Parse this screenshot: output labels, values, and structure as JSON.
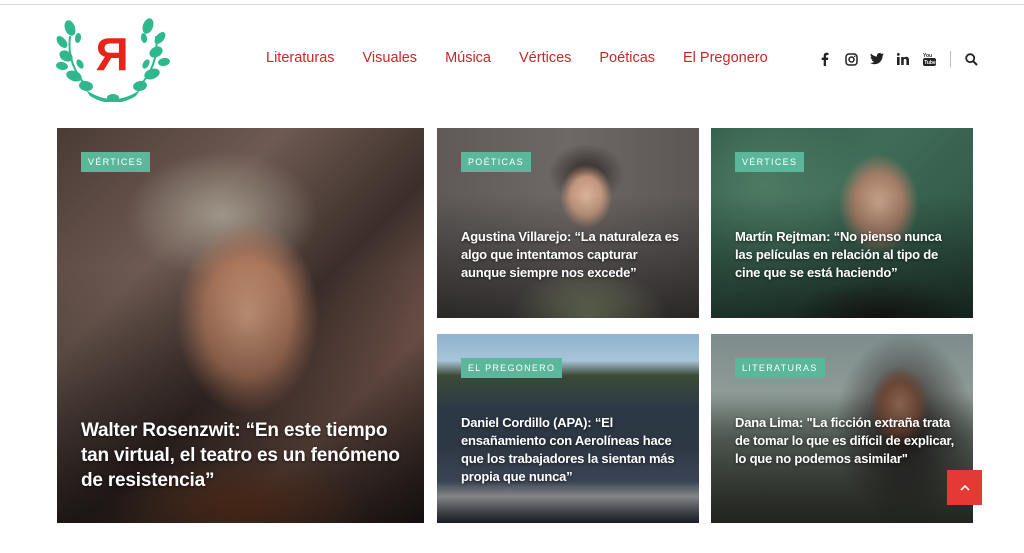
{
  "site": {
    "logo_letter": "R",
    "brand_color": "#e8241a",
    "laurel_color": "#2fb88e"
  },
  "nav": {
    "items": [
      {
        "label": "Literaturas"
      },
      {
        "label": "Visuales"
      },
      {
        "label": "Música"
      },
      {
        "label": "Vértices"
      },
      {
        "label": "Poéticas"
      },
      {
        "label": "El Pregonero"
      }
    ],
    "color": "#c62828"
  },
  "social": {
    "icons": [
      "facebook-icon",
      "instagram-icon",
      "twitter-icon",
      "linkedin-icon",
      "youtube-icon"
    ],
    "search_icon": "search-icon"
  },
  "articles": [
    {
      "category": "Vértices",
      "title": "Walter Rosenzwit: “En este tiempo tan virtual, el teatro es un fenómeno de resistencia”"
    },
    {
      "category": "Poéticas",
      "title": "Agustina Villarejo: “La naturaleza es algo que intentamos capturar aunque siempre nos excede”"
    },
    {
      "category": "Vértices",
      "title": "Martín Rejtman: “No pienso nunca las películas en relación al tipo de cine que se está haciendo”"
    },
    {
      "category": "El Pregonero",
      "title": "Daniel Cordillo (APA): “El ensañamiento con Aerolíneas hace que los trabajadores la sientan más propia que nunca”"
    },
    {
      "category": "Literaturas",
      "title": "Dana Lima: \"La ficción extraña trata de tomar lo que es difícil de explicar, lo que no podemos asimilar\""
    }
  ],
  "tag_color": "#5bb79a",
  "scroll_top": {
    "icon": "chevron-up-icon",
    "color": "#e53935"
  }
}
